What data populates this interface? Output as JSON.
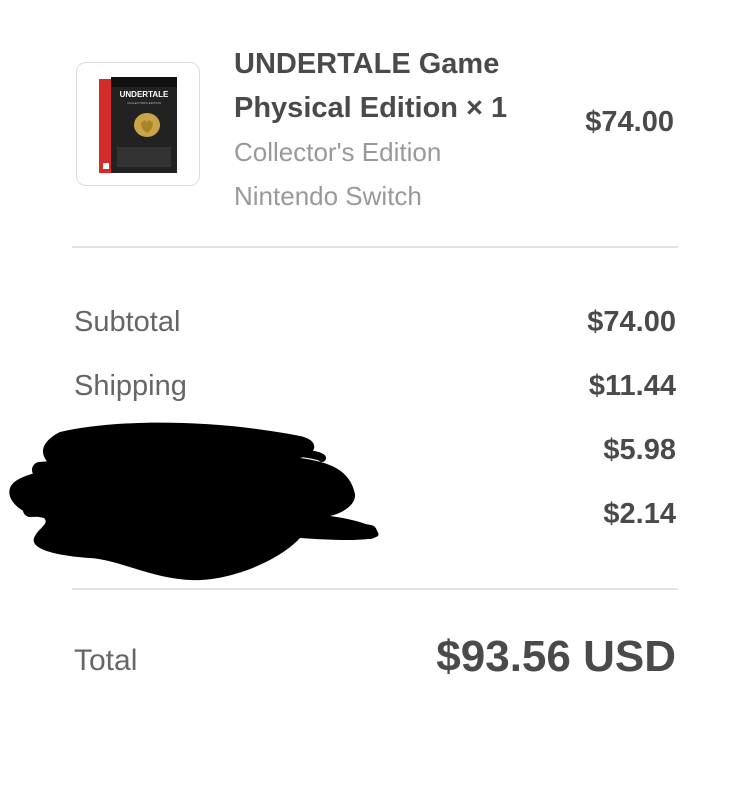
{
  "product": {
    "title_line1": "UNDERTALE Game",
    "title_line2": "Physical Edition × 1",
    "edition": "Collector's Edition",
    "platform": "Nintendo Switch",
    "price": "$74.00",
    "box_art_text": "UNDERTALE",
    "box_art_subtext": "COLLECTOR'S EDITION"
  },
  "summary": {
    "subtotal_label": "Subtotal",
    "subtotal_value": "$74.00",
    "shipping_label": "Shipping",
    "shipping_value": "$11.44",
    "line3_value": "$5.98",
    "line4_value": "$2.14"
  },
  "total": {
    "label": "Total",
    "value": "$93.56 USD"
  },
  "colors": {
    "text_dark": "#4a4a4a",
    "text_muted": "#999999",
    "divider": "#e2e2e2",
    "box_red": "#d52b2b",
    "redaction": "#000000"
  }
}
